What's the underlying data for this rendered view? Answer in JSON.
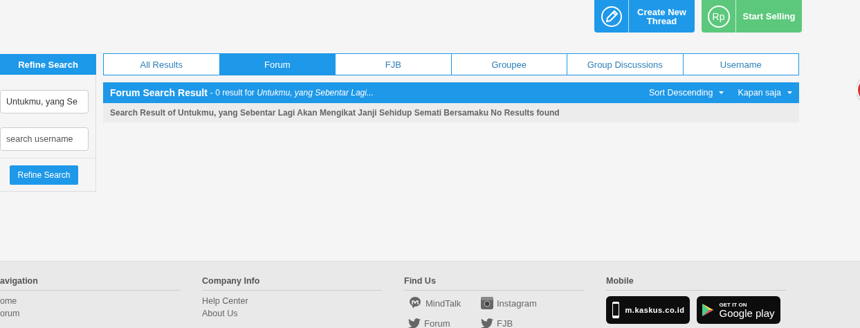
{
  "header_actions": [
    {
      "kind": "thread",
      "label": "Create New Thread"
    },
    {
      "kind": "sell",
      "badge": "Rp",
      "label": "Start Selling"
    }
  ],
  "sidebar": {
    "title": "Refine Search",
    "keyword_field": {
      "value": "Untukmu, yang Se"
    },
    "username_field": {
      "placeholder": "search username"
    },
    "button": "Refine Search"
  },
  "tabs": [
    {
      "label": "All Results",
      "selected": false
    },
    {
      "label": "Forum",
      "selected": true
    },
    {
      "label": "FJB",
      "selected": false
    },
    {
      "label": "Groupee",
      "selected": false
    },
    {
      "label": "Group Discussions",
      "selected": false
    },
    {
      "label": "Username",
      "selected": false
    }
  ],
  "results": {
    "title": "Forum Search Result",
    "summary": "- 0 result for *Untukmu, yang Sebentar Lagi...*",
    "dropdowns": [
      "Sort Descending",
      "Kapan saja"
    ],
    "message": "Search Result of Untukmu, yang Sebentar Lagi Akan Mengikat Janji Sehidup Semati Bersamaku No Results found"
  },
  "footer": {
    "columns": [
      {
        "kind": "links",
        "heading": "avigation",
        "items": [
          {
            "label": "ome"
          },
          {
            "label": "orum"
          }
        ]
      },
      {
        "kind": "links",
        "heading": "Company Info",
        "items": [
          {
            "label": "Help Center"
          },
          {
            "label": "About Us"
          }
        ]
      },
      {
        "kind": "social",
        "heading": "Find Us",
        "items": [
          {
            "kind": "mindtalk",
            "label": "MindTalk"
          },
          {
            "kind": "instagram",
            "label": "Instagram"
          },
          {
            "kind": "twitter",
            "label": "Forum"
          },
          {
            "kind": "twitter",
            "label": "FJB"
          }
        ]
      },
      {
        "kind": "apps",
        "heading": "Mobile",
        "items": [
          {
            "kind": "mobile-site",
            "label": "m.kaskus.co.id"
          },
          {
            "kind": "google-play",
            "caption": "GET IT ON",
            "label": "Google play"
          }
        ]
      }
    ]
  }
}
